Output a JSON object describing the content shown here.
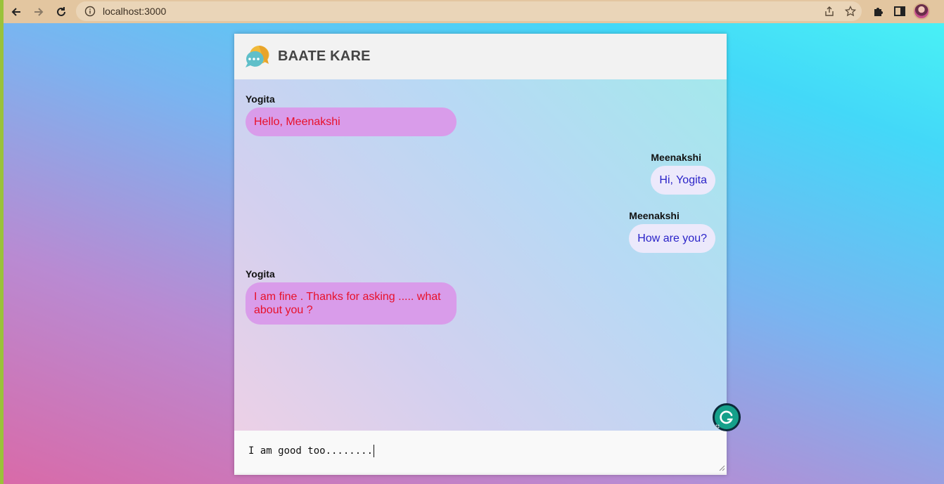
{
  "browser": {
    "url": "localhost:3000"
  },
  "app": {
    "title": "BAATE KARE"
  },
  "messages": [
    {
      "sender": "Yogita",
      "text": "Hello, Meenakshi",
      "side": "left"
    },
    {
      "sender": "Meenakshi",
      "text": "Hi, Yogita",
      "side": "right"
    },
    {
      "sender": "Meenakshi",
      "text": "How are you?",
      "side": "right"
    },
    {
      "sender": "Yogita",
      "text": "I am fine . Thanks for asking ..... what about you ?",
      "side": "left"
    }
  ],
  "composer": {
    "value": "I am good too........"
  },
  "colors": {
    "incoming_bubble": "#d99cea",
    "incoming_text": "#e8102a",
    "outgoing_bubble": "#ece9fb",
    "outgoing_text": "#2a23c8",
    "grammarly": "#15a08a"
  },
  "icons": [
    "back-icon",
    "forward-icon",
    "reload-icon",
    "info-icon",
    "share-icon",
    "star-icon",
    "extensions-icon",
    "side-panel-icon",
    "chat-logo-icon",
    "grammarly-icon"
  ]
}
